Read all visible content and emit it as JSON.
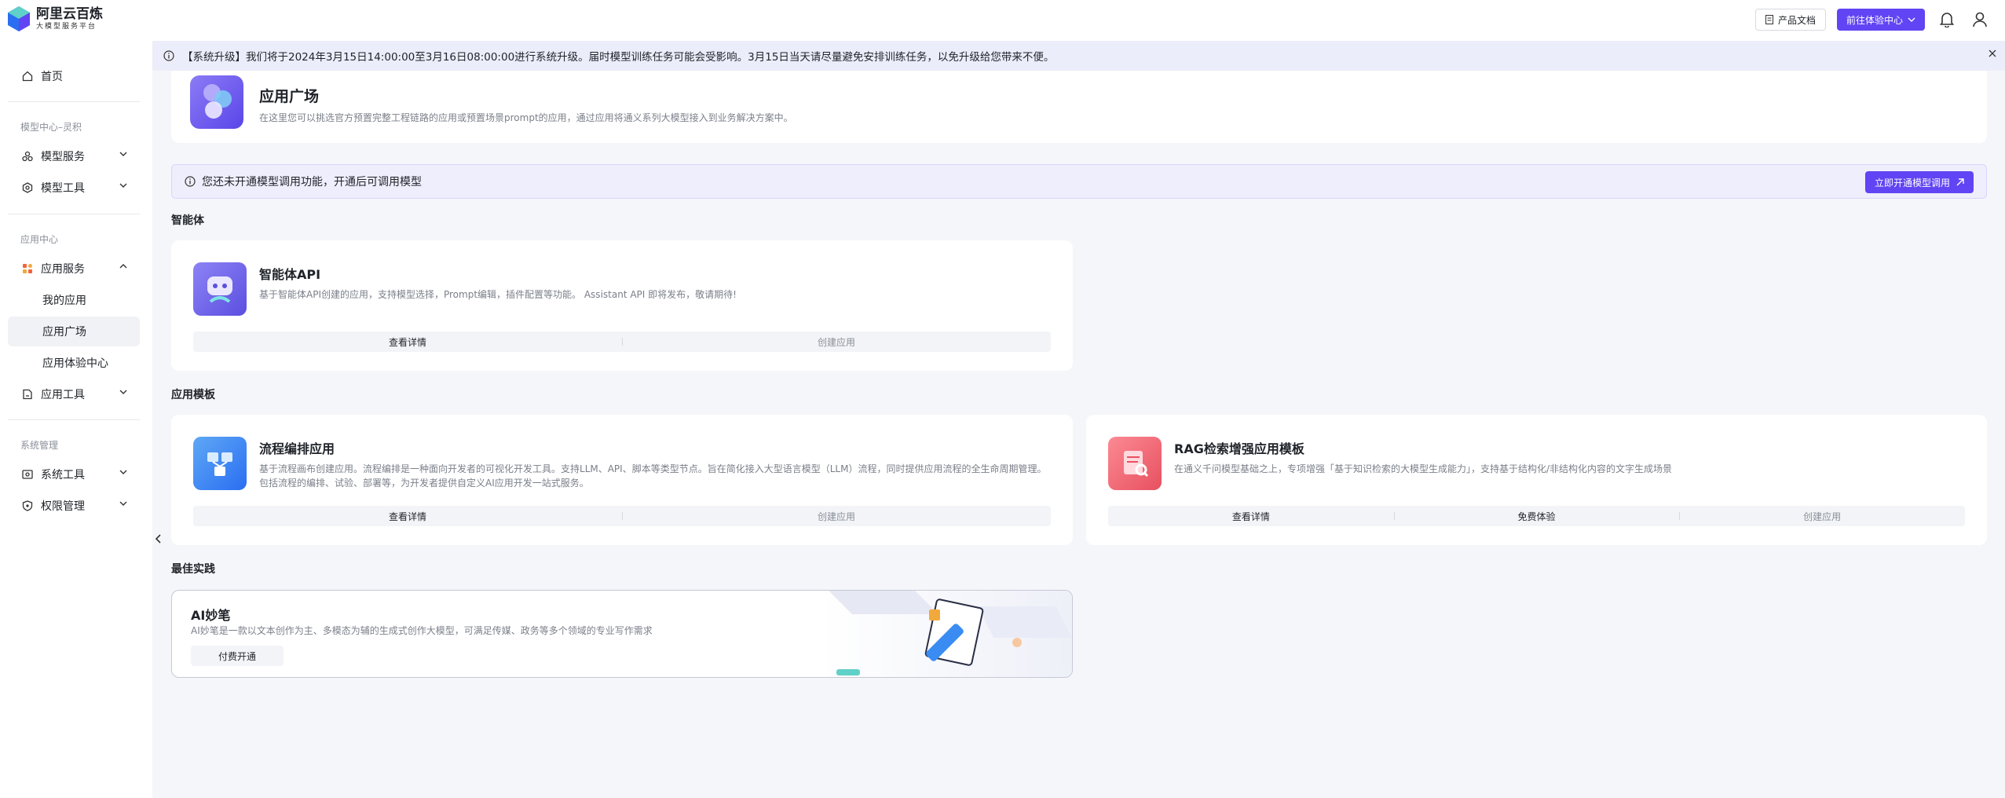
{
  "brand": {
    "title": "阿里云百炼",
    "subtitle": "大模型服务平台"
  },
  "topbar": {
    "docs_label": "产品文档",
    "experience_label": "前往体验中心"
  },
  "sidebar": {
    "home": "首页",
    "group_model": "模型中心–灵积",
    "model_service": "模型服务",
    "model_tools": "模型工具",
    "group_app": "应用中心",
    "app_service": "应用服务",
    "my_apps": "我的应用",
    "app_square": "应用广场",
    "app_experience": "应用体验中心",
    "app_tools": "应用工具",
    "group_system": "系统管理",
    "system_tools": "系统工具",
    "permission": "权限管理"
  },
  "banner": {
    "text": "【系统升级】我们将于2024年3月15日14:00:00至3月16日08:00:00进行系统升级。届时模型训练任务可能会受影响。3月15日当天请尽量避免安排训练任务，以免升级给您带来不便。"
  },
  "header": {
    "title": "应用广场",
    "desc": "在这里您可以挑选官方预置完整工程链路的应用或预置场景prompt的应用，通过应用将通义系列大模型接入到业务解决方案中。"
  },
  "notice": {
    "text": "您还未开通模型调用功能，开通后可调用模型",
    "button": "立即开通模型调用"
  },
  "sections": {
    "agent": "智能体",
    "templates": "应用模板",
    "best": "最佳实践"
  },
  "cards": {
    "agent_api": {
      "title": "智能体API",
      "desc": "基于智能体API创建的应用，支持模型选择，Prompt编辑，插件配置等功能。 Assistant API 即将发布，敬请期待!",
      "view": "查看详情",
      "create": "创建应用"
    },
    "flow": {
      "title": "流程编排应用",
      "desc1": "基于流程画布创建应用。流程编排是一种面向开发者的可视化开发工具。支持LLM、API、脚本等类型节点。旨在简化接入大型语言模型（LLM）流程，同时提供应用流程的全生命周期管理。",
      "desc2": "包括流程的编排、试验、部署等，为开发者提供自定义AI应用开发一站式服务。",
      "view": "查看详情",
      "create": "创建应用"
    },
    "rag": {
      "title": "RAG检索增强应用模板",
      "desc": "在通义千问模型基础之上，专项增强「基于知识检索的大模型生成能力」，支持基于结构化/非结构化内容的文字生成场景",
      "view": "查看详情",
      "try": "免费体验",
      "create": "创建应用"
    }
  },
  "best": {
    "title": "AI妙笔",
    "desc": "AI妙笔是一款以文本创作为主、多模态为辅的生成式创作大模型，可满足传媒、政务等多个领域的专业写作需求",
    "button": "付费开通"
  },
  "colors": {
    "accent": "#6144f3",
    "banner_bg": "#ecedfa"
  }
}
